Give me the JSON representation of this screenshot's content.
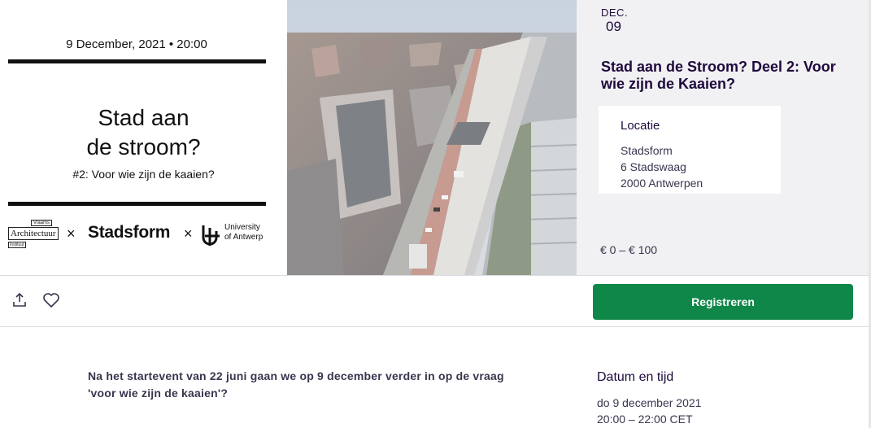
{
  "poster": {
    "date_line": "9 December, 2021 • 20:00",
    "title_line1": "Stad aan",
    "title_line2": "de stroom?",
    "subtitle": "#2: Voor wie zijn de kaaien?",
    "logos": {
      "va_top": "Vlaams",
      "va_main": "Architectuur",
      "va_bottom": "Instituut",
      "separator": "×",
      "stadsform": "Stadsform",
      "ua_line1": "University",
      "ua_line2": "of Antwerp"
    }
  },
  "event": {
    "month": "DEC.",
    "day": "09",
    "title": "Stad aan de Stroom? Deel 2: Voor wie zijn de Kaaien?",
    "location_label": "Locatie",
    "location_lines": [
      "Stadsform",
      "6 Stadswaag",
      "2000 Antwerpen"
    ],
    "price": "€ 0 – € 100"
  },
  "actions": {
    "share_icon": "share-icon",
    "like_icon": "heart-icon",
    "register_label": "Registreren",
    "register_color": "#0f8749"
  },
  "details": {
    "summary": "Na het startevent van 22 juni gaan we op 9 december verder in op de vraag 'voor wie zijn de kaaien'?",
    "datetime_heading": "Datum en tijd",
    "date": "do 9 december 2021",
    "time": "20:00 – 22:00 CET"
  }
}
